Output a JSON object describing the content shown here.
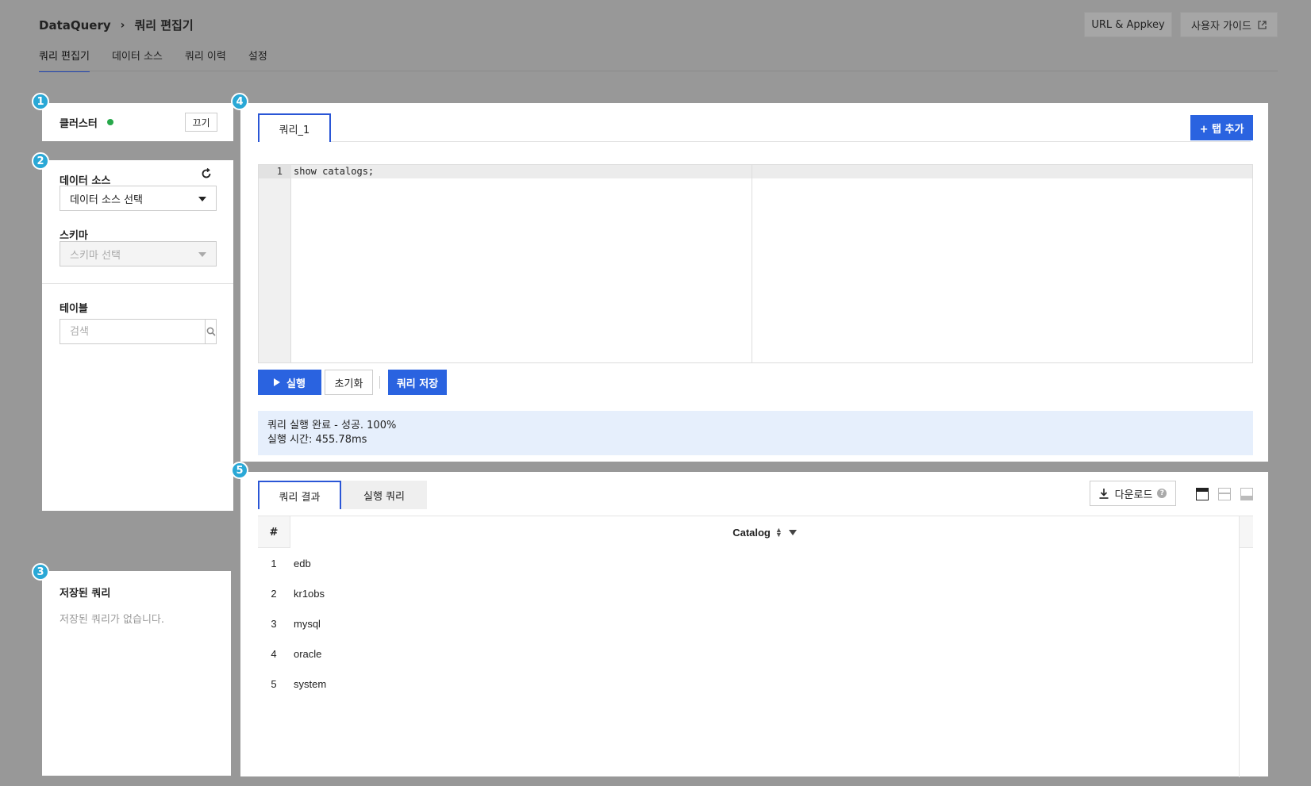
{
  "header": {
    "breadcrumb": [
      "DataQuery",
      "쿼리 편집기"
    ],
    "buttons": {
      "url_appkey": "URL & Appkey",
      "user_guide": "사용자 가이드"
    }
  },
  "nav": {
    "tabs": [
      "쿼리 편집기",
      "데이터 소스",
      "쿼리 이력",
      "설정"
    ],
    "active": 0
  },
  "badges": [
    "1",
    "2",
    "3",
    "4",
    "5"
  ],
  "cluster": {
    "title": "클러스터",
    "status_color": "#27a84a",
    "toggle_label": "끄기"
  },
  "datasource": {
    "title": "데이터 소스",
    "select_value": "데이터 소스 선택",
    "schema_label": "스키마",
    "schema_placeholder": "스키마 선택",
    "table_label": "테이블",
    "search_placeholder": "검색"
  },
  "saved_queries": {
    "title": "저장된 쿼리",
    "empty_text": "저장된 쿼리가 없습니다."
  },
  "editor": {
    "tab_label": "쿼리_1",
    "add_tab_label": "+ 탭 추가",
    "line_number": "1",
    "code": "show catalogs;",
    "run_label": "실행",
    "reset_label": "초기화",
    "save_label": "쿼리 저장",
    "status_line1": "쿼리 실행 완료 - 성공. 100%",
    "status_line2": "실행 시간: 455.78ms"
  },
  "results": {
    "tabs": [
      "쿼리 결과",
      "실행 쿼리"
    ],
    "download_label": "다운로드",
    "columns": [
      "#",
      "Catalog"
    ],
    "rows": [
      {
        "num": "1",
        "catalog": "edb"
      },
      {
        "num": "2",
        "catalog": "kr1obs"
      },
      {
        "num": "3",
        "catalog": "mysql"
      },
      {
        "num": "4",
        "catalog": "oracle"
      },
      {
        "num": "5",
        "catalog": "system"
      }
    ]
  },
  "colors": {
    "accent": "#2a63e0",
    "badge": "#2aa8d6",
    "status_bg": "#e6effc"
  }
}
